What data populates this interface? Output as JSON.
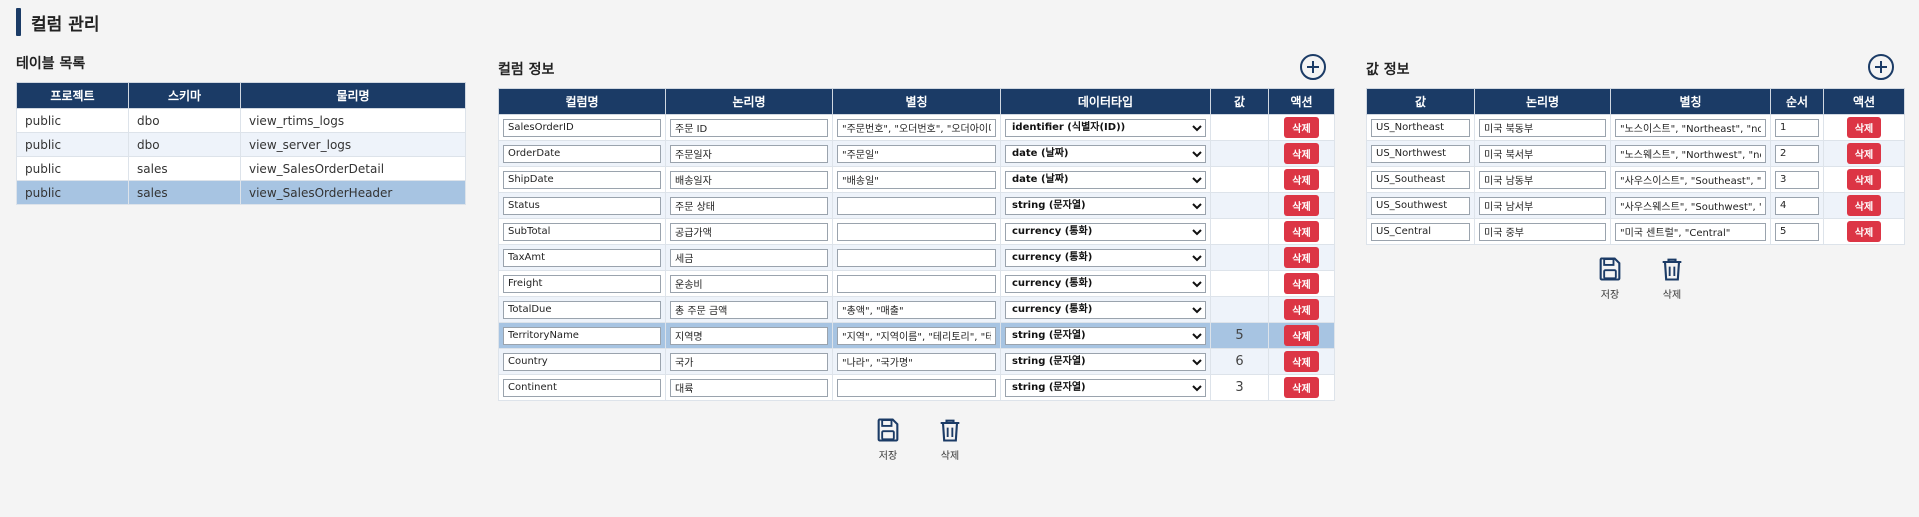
{
  "page": {
    "title": "컬럼 관리"
  },
  "tables_panel": {
    "title": "테이블 목록",
    "headers": [
      "프로젝트",
      "스키마",
      "물리명"
    ],
    "rows": [
      {
        "project": "public",
        "schema": "dbo",
        "physical": "view_rtims_logs"
      },
      {
        "project": "public",
        "schema": "dbo",
        "physical": "view_server_logs"
      },
      {
        "project": "public",
        "schema": "sales",
        "physical": "view_SalesOrderDetail"
      },
      {
        "project": "public",
        "schema": "sales",
        "physical": "view_SalesOrderHeader"
      }
    ]
  },
  "columns_panel": {
    "title": "컬럼 정보",
    "headers": [
      "컬럼명",
      "논리명",
      "별칭",
      "데이터타입",
      "값",
      "액션"
    ],
    "rows": [
      {
        "name": "SalesOrderID",
        "logical": "주문 ID",
        "alias": "\"주문번호\", \"오더번호\", \"오더아이디\"",
        "type": "identifier (식별자(ID))",
        "value": "",
        "action": "삭제"
      },
      {
        "name": "OrderDate",
        "logical": "주문일자",
        "alias": "\"주문일\"",
        "type": "date (날짜)",
        "value": "",
        "action": "삭제"
      },
      {
        "name": "ShipDate",
        "logical": "배송일자",
        "alias": "\"배송일\"",
        "type": "date (날짜)",
        "value": "",
        "action": "삭제"
      },
      {
        "name": "Status",
        "logical": "주문 상태",
        "alias": "",
        "type": "string (문자열)",
        "value": "",
        "action": "삭제"
      },
      {
        "name": "SubTotal",
        "logical": "공급가액",
        "alias": "",
        "type": "currency (통화)",
        "value": "",
        "action": "삭제"
      },
      {
        "name": "TaxAmt",
        "logical": "세금",
        "alias": "",
        "type": "currency (통화)",
        "value": "",
        "action": "삭제"
      },
      {
        "name": "Freight",
        "logical": "운송비",
        "alias": "",
        "type": "currency (통화)",
        "value": "",
        "action": "삭제"
      },
      {
        "name": "TotalDue",
        "logical": "총 주문 금액",
        "alias": "\"총액\", \"매출\"",
        "type": "currency (통화)",
        "value": "",
        "action": "삭제"
      },
      {
        "name": "TerritoryName",
        "logical": "지역명",
        "alias": "\"지역\", \"지역이름\", \"테리토리\", \"테리토리명\"",
        "type": "string (문자열)",
        "value": "5",
        "action": "삭제"
      },
      {
        "name": "Country",
        "logical": "국가",
        "alias": "\"나라\", \"국가명\"",
        "type": "string (문자열)",
        "value": "6",
        "action": "삭제"
      },
      {
        "name": "Continent",
        "logical": "대륙",
        "alias": "",
        "type": "string (문자열)",
        "value": "3",
        "action": "삭제"
      }
    ],
    "save_label": "저장",
    "delete_label": "삭제"
  },
  "values_panel": {
    "title": "값 정보",
    "headers": [
      "값",
      "논리명",
      "별칭",
      "순서",
      "액션"
    ],
    "rows": [
      {
        "value": "US_Northeast",
        "logical": "미국 북동부",
        "alias": "\"노스이스트\", \"Northeast\", \"northeast\"",
        "order": "1",
        "action": "삭제"
      },
      {
        "value": "US_Northwest",
        "logical": "미국 북서부",
        "alias": "\"노스웨스트\", \"Northwest\", \"northwest\"",
        "order": "2",
        "action": "삭제"
      },
      {
        "value": "US_Southeast",
        "logical": "미국 남동부",
        "alias": "\"사우스이스트\", \"Southeast\", \"southeast\"",
        "order": "3",
        "action": "삭제"
      },
      {
        "value": "US_Southwest",
        "logical": "미국 남서부",
        "alias": "\"사우스웨스트\", \"Southwest\", \"southwest\"",
        "order": "4",
        "action": "삭제"
      },
      {
        "value": "US_Central",
        "logical": "미국 중부",
        "alias": "\"미국 센트럴\", \"Central\"",
        "order": "5",
        "action": "삭제"
      }
    ],
    "save_label": "저장",
    "delete_label": "삭제"
  },
  "icons": {
    "add": "plus-circle-icon",
    "save": "floppy-disk-icon",
    "delete": "trash-icon"
  },
  "colors": {
    "header": "#1b3b66",
    "delete": "#dc3545",
    "selected_row": "#a7c4e2",
    "alt_row": "#eef3fa"
  }
}
